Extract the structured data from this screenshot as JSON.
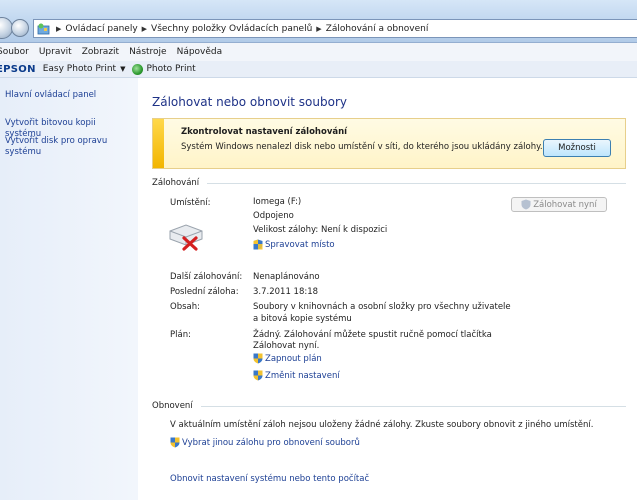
{
  "breadcrumb": [
    "Ovládací panely",
    "Všechny položky Ovládacích panelů",
    "Zálohování a obnovení"
  ],
  "menu": [
    "Soubor",
    "Upravit",
    "Zobrazit",
    "Nástroje",
    "Nápověda"
  ],
  "epson": {
    "logo": "EPSON",
    "easy": "Easy Photo Print",
    "photo": "Photo Print"
  },
  "left": {
    "home": "Hlavní ovládací panel",
    "image": "Vytvořit bitovou kopii systému",
    "disc": "Vytvořit disk pro opravu systému"
  },
  "main": {
    "title": "Zálohovat nebo obnovit soubory",
    "warn": {
      "heading": "Zkontrolovat nastavení zálohování",
      "text": "Systém Windows nenalezl disk nebo umístění v síti, do kterého jsou ukládány zálohy.",
      "button": "Možnosti"
    },
    "backup": {
      "heading": "Zálohování",
      "location_label": "Umístění:",
      "location": "Iomega (F:)",
      "status": "Odpojeno",
      "size": "Velikost zálohy: Není k dispozici",
      "manage": "Spravovat místo",
      "backup_now": "Zálohovat nyní",
      "next_label": "Další zálohování:",
      "next": "Nenaplánováno",
      "last_label": "Poslední záloha:",
      "last": "3.7.2011 18:18",
      "contents_label": "Obsah:",
      "contents_1": "Soubory v knihovnách a osobní složky pro všechny uživatele",
      "contents_2": "a bitová kopie systému",
      "plan_label": "Plán:",
      "plan_1": "Žádný. Zálohování můžete spustit ručně pomocí tlačítka",
      "plan_2": "Zálohovat nyní.",
      "enable": "Zapnout plán",
      "change": "Změnit nastavení"
    },
    "restore": {
      "heading": "Obnovení",
      "text": "V aktuálním umístění záloh nejsou uloženy žádné zálohy. Zkuste soubory obnovit z jiného umístění.",
      "select": "Vybrat jinou zálohu pro obnovení souborů",
      "recover": "Obnovit nastavení systému nebo tento počítač"
    }
  }
}
